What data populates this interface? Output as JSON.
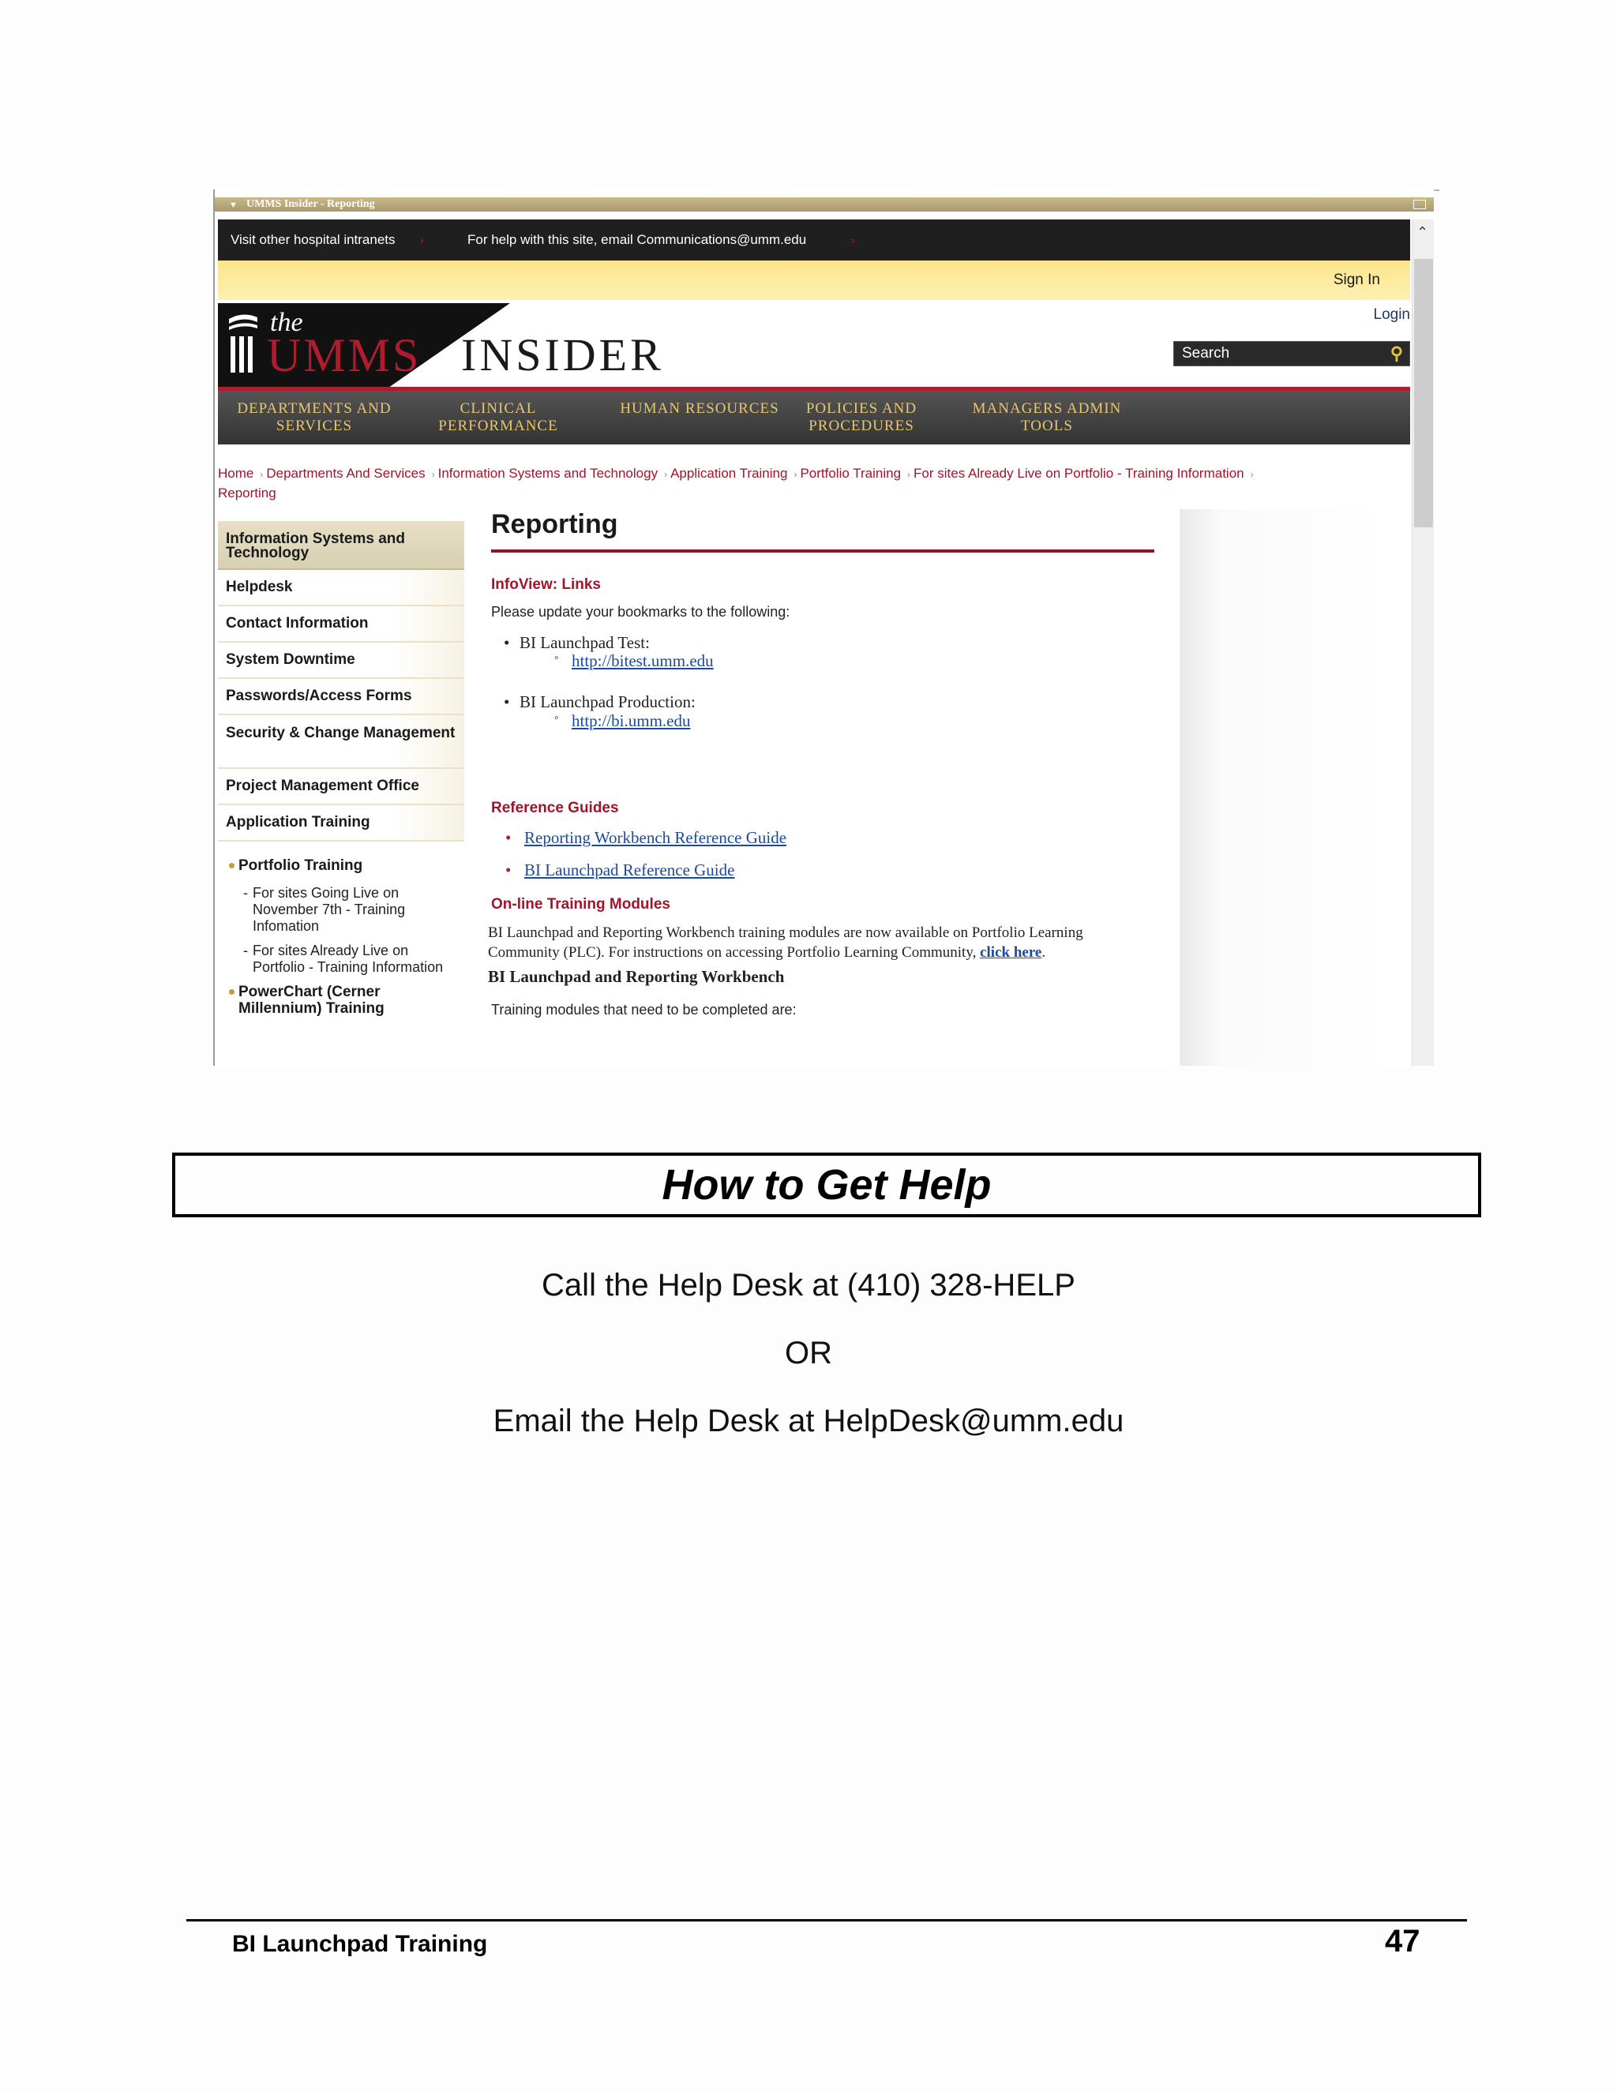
{
  "screenshot": {
    "window_title": "UMMS Insider - Reporting",
    "topbar": {
      "visit_link": "Visit other hospital intranets",
      "help_text": "For help with this site, email Communications@umm.edu"
    },
    "sign_in": "Sign In",
    "login": "Login",
    "logo": {
      "the": "the",
      "umms": "UMMS",
      "insider": "INSIDER"
    },
    "search_placeholder": "Search",
    "nav": [
      {
        "line1": "DEPARTMENTS AND",
        "line2": "SERVICES"
      },
      {
        "line1": "CLINICAL",
        "line2": "PERFORMANCE"
      },
      {
        "line1": "HUMAN RESOURCES",
        "line2": ""
      },
      {
        "line1": "POLICIES AND",
        "line2": "PROCEDURES"
      },
      {
        "line1": "MANAGERS ADMIN",
        "line2": "TOOLS"
      }
    ],
    "breadcrumb": [
      "Home",
      "Departments And Services",
      "Information Systems and Technology",
      "Application Training",
      "Portfolio Training",
      "For sites Already Live on Portfolio - Training Information",
      "Reporting"
    ],
    "sidebar": {
      "heading": "Information Systems and Technology",
      "items": [
        "Helpdesk",
        "Contact Information",
        "System Downtime",
        "Passwords/Access Forms",
        "Security & Change Management",
        "Project Management Office",
        "Application Training"
      ],
      "sub_portfolio": "Portfolio Training",
      "sub_going_live": "For sites Going Live on November 7th - Training Infomation",
      "sub_already_live": "For sites Already Live on Portfolio - Training Information",
      "sub_powerchart": "PowerChart (Cerner Millennium) Training"
    },
    "content": {
      "title": "Reporting",
      "infoview_heading": "InfoView: Links",
      "update_text": "Please update your bookmarks to the following:",
      "test_label": "BI Launchpad Test:",
      "test_url": "http://bitest.umm.edu",
      "prod_label": "BI Launchpad Production:",
      "prod_url": "http://bi.umm.edu",
      "ref_heading": "Reference Guides",
      "ref_guides": [
        "Reporting Workbench Reference Guide",
        "BI Launchpad Reference Guide"
      ],
      "online_heading": "On-line Training Modules",
      "online_text_1": "BI Launchpad and Reporting Workbench training modules are now available on Portfolio Learning",
      "online_text_2": "Community (PLC).  For instructions on accessing Portfolio Learning Community,",
      "click_here": "click here",
      "bi_rw_heading": "BI Launchpad and Reporting Workbench",
      "modules_text": "Training modules that need to be completed are:"
    }
  },
  "help": {
    "title": "How to Get Help",
    "call": "Call the Help Desk at (410) 328-HELP",
    "or": "OR",
    "email": "Email the Help Desk at HelpDesk@umm.edu"
  },
  "footer": {
    "title": "BI Launchpad Training",
    "page_number": "47"
  }
}
